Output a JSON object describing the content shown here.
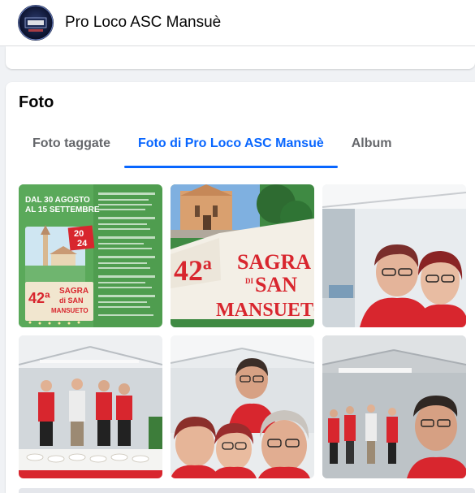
{
  "header": {
    "page_name": "Pro Loco ASC Mansuè"
  },
  "photos_section": {
    "title": "Foto",
    "tabs": [
      {
        "label": "Foto taggate",
        "active": false
      },
      {
        "label": "Foto di Pro Loco ASC Mansuè",
        "active": true
      },
      {
        "label": "Album",
        "active": false
      }
    ]
  },
  "photos": {
    "poster": {
      "date_line1": "DAL 30 AGOSTO",
      "date_line2": "AL 15 SETTEMBRE",
      "year_top": "20",
      "year_bottom": "24",
      "edition": "42ª",
      "sagra": "SAGRA",
      "di_san": "di SAN",
      "mansueto": "MANSUETO"
    },
    "sagra_banner": {
      "edition": "42ª",
      "line1": "SAGRA",
      "line2": "SAN",
      "di": "DI",
      "line3": "MANSUETO"
    }
  },
  "colors": {
    "accent": "#0866ff",
    "tab_inactive": "#65676b",
    "brand_red": "#d8262e",
    "poster_green": "#4a9a4a"
  }
}
